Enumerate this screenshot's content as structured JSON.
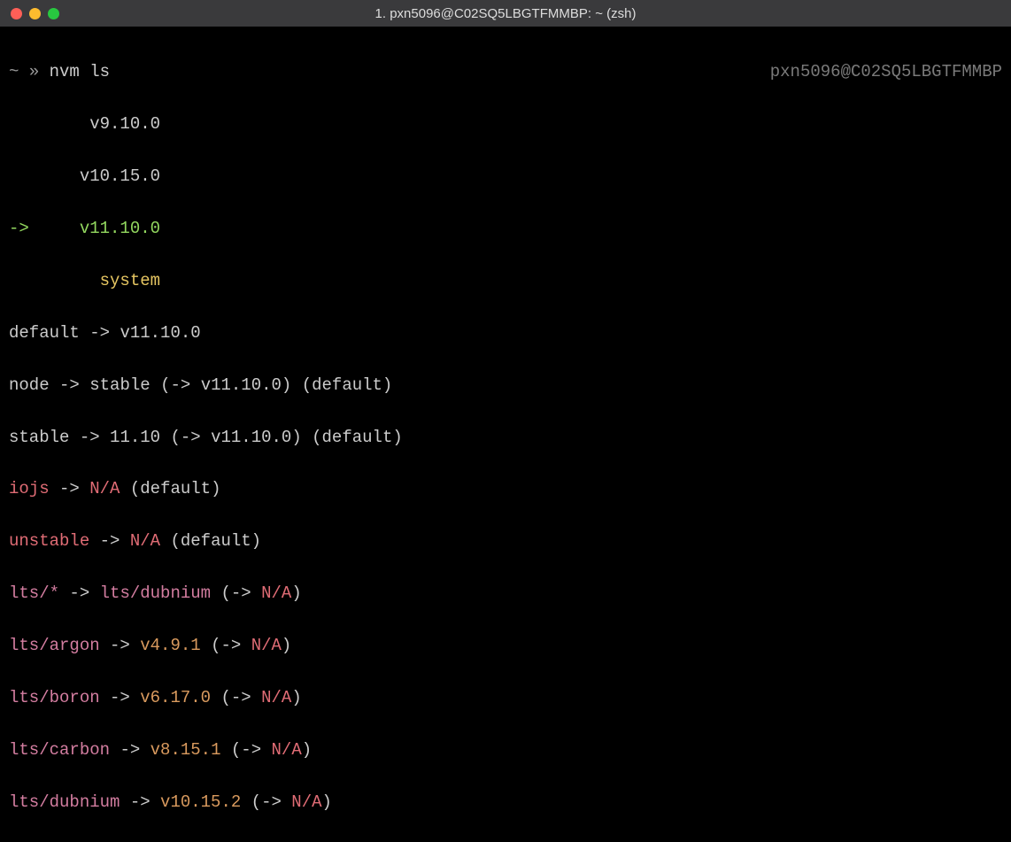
{
  "titlebar": {
    "title": "1. pxn5096@C02SQ5LBGTFMMBP: ~ (zsh)"
  },
  "prompt": {
    "ps1_tilde": "~",
    "ps1_arrow": "»",
    "command": "nvm ls",
    "rprompt": "pxn5096@C02SQ5LBGTFMMBP"
  },
  "versions": {
    "v1": "v9.10.0",
    "v2": "v10.15.0",
    "current_arrow": "->",
    "v3": "v11.10.0",
    "system": "system"
  },
  "aliases": {
    "default": {
      "name": "default",
      "arrow": "->",
      "target": "v11.10.0"
    },
    "node": {
      "name": "node",
      "arrow": "->",
      "target": "stable",
      "res_open": "(->",
      "res": "v11.10.0",
      "res_close": ")",
      "tag": "(default)"
    },
    "stable": {
      "name": "stable",
      "arrow": "->",
      "target": "11.10",
      "res_open": "(->",
      "res": "v11.10.0",
      "res_close": ")",
      "tag": "(default)"
    },
    "iojs": {
      "name": "iojs",
      "arrow": "->",
      "target": "N/A",
      "tag": "(default)"
    },
    "unstable": {
      "name": "unstable",
      "arrow": "->",
      "target": "N/A",
      "tag": "(default)"
    },
    "lts_star": {
      "name": "lts/*",
      "arrow": "->",
      "target": "lts/dubnium",
      "res_open": "(->",
      "res": "N/A",
      "res_close": ")"
    },
    "lts_argon": {
      "name": "lts/argon",
      "arrow": "->",
      "target": "v4.9.1",
      "res_open": "(->",
      "res": "N/A",
      "res_close": ")"
    },
    "lts_boron": {
      "name": "lts/boron",
      "arrow": "->",
      "target": "v6.17.0",
      "res_open": "(->",
      "res": "N/A",
      "res_close": ")"
    },
    "lts_carbon": {
      "name": "lts/carbon",
      "arrow": "->",
      "target": "v8.15.1",
      "res_open": "(->",
      "res": "N/A",
      "res_close": ")"
    },
    "lts_dubnium": {
      "name": "lts/dubnium",
      "arrow": "->",
      "target": "v10.15.2",
      "res_open": "(->",
      "res": "N/A",
      "res_close": ")"
    }
  }
}
